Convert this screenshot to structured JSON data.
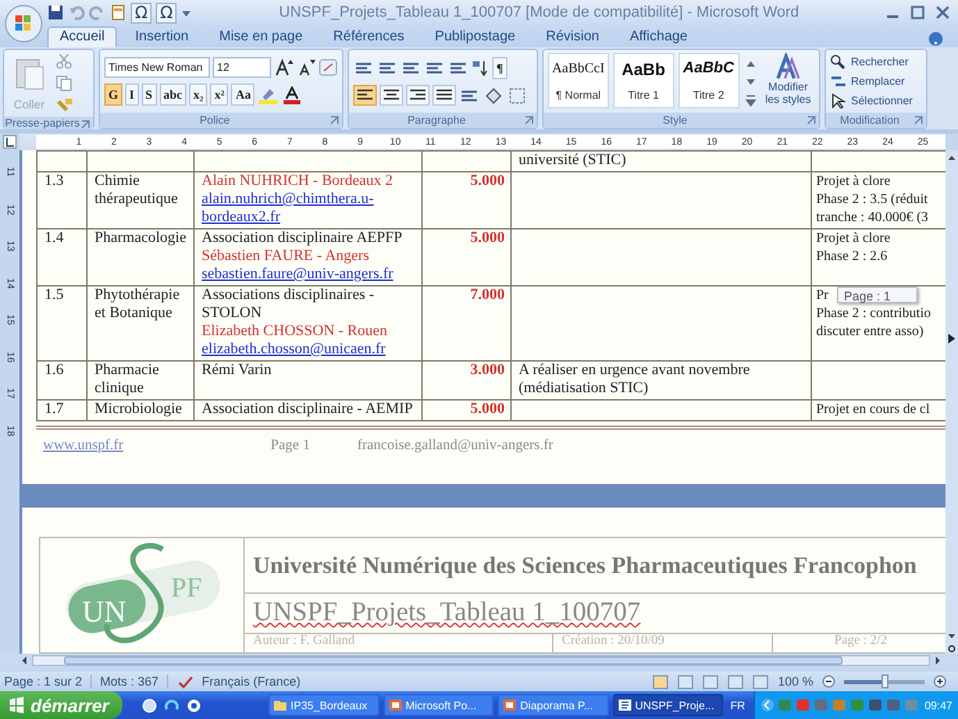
{
  "window": {
    "title": "UNSPF_Projets_Tableau 1_100707 [Mode de compatibilité] - Microsoft Word",
    "symbol_buttons": [
      "Ω",
      "Ω"
    ]
  },
  "ribbon_tabs": [
    {
      "label": "Accueil",
      "selected": true
    },
    {
      "label": "Insertion",
      "selected": false
    },
    {
      "label": "Mise en page",
      "selected": false
    },
    {
      "label": "Références",
      "selected": false
    },
    {
      "label": "Publipostage",
      "selected": false
    },
    {
      "label": "Révision",
      "selected": false
    },
    {
      "label": "Affichage",
      "selected": false
    }
  ],
  "clipboard": {
    "label": "Presse-papiers",
    "paste": {
      "label": "Coller",
      "disabled": true
    }
  },
  "font": {
    "label": "Police",
    "font_name": "Times New Roman",
    "font_size": "12",
    "format_buttons": [
      {
        "label": "G",
        "on": true
      },
      {
        "label": "I",
        "on": false
      },
      {
        "label": "S",
        "on": false
      },
      {
        "label": "abc",
        "on": false
      },
      {
        "label": "x₂",
        "on": false
      },
      {
        "label": "x²",
        "on": false
      },
      {
        "label": "Aa",
        "on": false
      }
    ]
  },
  "paragraph": {
    "label": "Paragraphe",
    "pilcrow": "¶",
    "alignment": [
      {
        "selected": true
      },
      {
        "selected": false
      },
      {
        "selected": false
      },
      {
        "selected": false
      }
    ]
  },
  "styles": {
    "label": "Style",
    "items": [
      {
        "preview": "AaBbCcI",
        "name": "¶ Normal"
      },
      {
        "preview": "AaBb",
        "name": "Titre 1"
      },
      {
        "preview": "AaBbC",
        "name": "Titre 2"
      }
    ],
    "change": "Modifier les styles"
  },
  "editing": {
    "label": "Modification",
    "commands": [
      "Rechercher",
      "Remplacer",
      "Sélectionner"
    ]
  },
  "ruler": {
    "marks": [
      "1",
      "2",
      "3",
      "4",
      "5",
      "6",
      "7",
      "8",
      "9",
      "10",
      "11",
      "12",
      "13",
      "14",
      "15",
      "16",
      "17",
      "18",
      "19",
      "20",
      "21",
      "22",
      "23",
      "24",
      "25"
    ],
    "vertical_marks": [
      "11",
      "12",
      "13",
      "14",
      "15",
      "16",
      "17",
      "18"
    ]
  },
  "table": {
    "rows": [
      {
        "number": "",
        "discipline": "",
        "contacts": [],
        "amount": "",
        "remark": "université (STIC)",
        "status": []
      },
      {
        "number": "1.3",
        "discipline": "Chimie thérapeutique",
        "contacts": [
          {
            "kind": "name",
            "text": "Alain NUHRICH - Bordeaux 2"
          },
          {
            "kind": "email",
            "text": "alain.nuhrich@chimthera.u-bordeaux2.fr"
          }
        ],
        "amount": "5.000",
        "remark": "",
        "status": [
          "Projet à clore",
          "Phase 2 : 3.5 (réduit",
          "tranche : 40.000€ (3"
        ]
      },
      {
        "number": "1.4",
        "discipline": "Pharmacologie",
        "contacts": [
          {
            "kind": "text",
            "text": "Association disciplinaire AEPFP"
          },
          {
            "kind": "name",
            "text": "Sébastien FAURE - Angers"
          },
          {
            "kind": "email",
            "text": "sebastien.faure@univ-angers.fr"
          }
        ],
        "amount": "5.000",
        "remark": "",
        "status": [
          "Projet à clore",
          "Phase 2 : 2.6"
        ]
      },
      {
        "number": "1.5",
        "discipline": "Phytothérapie et Botanique",
        "contacts": [
          {
            "kind": "text",
            "text": "Associations disciplinaires - STOLON"
          },
          {
            "kind": "name",
            "text": "Elizabeth CHOSSON - Rouen"
          },
          {
            "kind": "email",
            "text": "elizabeth.chosson@unicaen.fr"
          }
        ],
        "amount": "7.000",
        "remark": "",
        "status": [
          "Pr",
          "Phase 2 : contributio",
          "discuter entre asso)"
        ],
        "tooltip": "Page : 1"
      },
      {
        "number": "1.6",
        "discipline": "Pharmacie clinique",
        "contacts": [
          {
            "kind": "text",
            "text": "Rémi Varin"
          }
        ],
        "amount": "3.000",
        "remark": "A réaliser en urgence avant novembre (médiatisation STIC)",
        "status": []
      },
      {
        "number": "1.7",
        "discipline": "Microbiologie",
        "contacts": [
          {
            "kind": "text",
            "text": "Association disciplinaire - AEMIP"
          }
        ],
        "amount": "5.000",
        "remark": "",
        "status": [
          "Projet en cours de cl"
        ]
      }
    ]
  },
  "footer": {
    "link": "www.unspf.fr",
    "page": "Page 1",
    "email": "francoise.galland@univ-angers.fr"
  },
  "page2_header": {
    "logo_text": [
      "UN",
      "PF"
    ],
    "title": "Université Numérique des Sciences Pharmaceutiques Francophon",
    "document": "UNSPF_Projets_Tableau 1_100707",
    "author": "Auteur : F. Galland",
    "created": "Création : 20/10/09",
    "page": "Page : 2/2"
  },
  "status_bar": {
    "page": "Page : 1 sur 2",
    "words": "Mots : 367",
    "language": "Français (France)",
    "zoom": "100 %",
    "level": 0.5
  },
  "taskbar": {
    "start": "démarrer",
    "windows": [
      {
        "label": "IP35_Bordeaux",
        "kind": "folder",
        "selected": false
      },
      {
        "label": "Microsoft Po...",
        "kind": "powerpoint",
        "selected": false
      },
      {
        "label": "Diaporama P...",
        "kind": "powerpoint",
        "selected": false
      },
      {
        "label": "UNSPF_Proje...",
        "kind": "word",
        "selected": true
      }
    ],
    "language": "FR",
    "time": "09:47"
  }
}
